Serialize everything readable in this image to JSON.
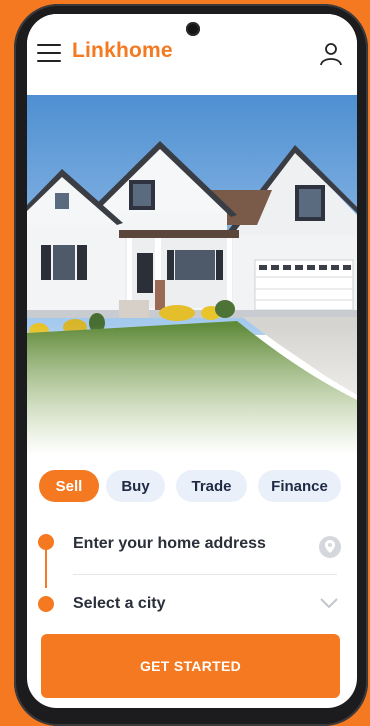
{
  "app": {
    "logo_text": "Linkhome",
    "brand_color": "#f47920"
  },
  "header": {
    "menu_icon": "hamburger-menu-icon",
    "account_icon": "user-account-icon"
  },
  "hero": {
    "image": "house-exterior-photo"
  },
  "tabs": [
    {
      "label": "Sell",
      "active": true
    },
    {
      "label": "Buy",
      "active": false
    },
    {
      "label": "Trade",
      "active": false
    },
    {
      "label": "Finance",
      "active": false
    }
  ],
  "form": {
    "address_placeholder": "Enter your home address",
    "address_icon": "location-pin-icon",
    "city_placeholder": "Select a city",
    "city_icon": "chevron-down-icon"
  },
  "cta": {
    "label": "GET STARTED"
  }
}
